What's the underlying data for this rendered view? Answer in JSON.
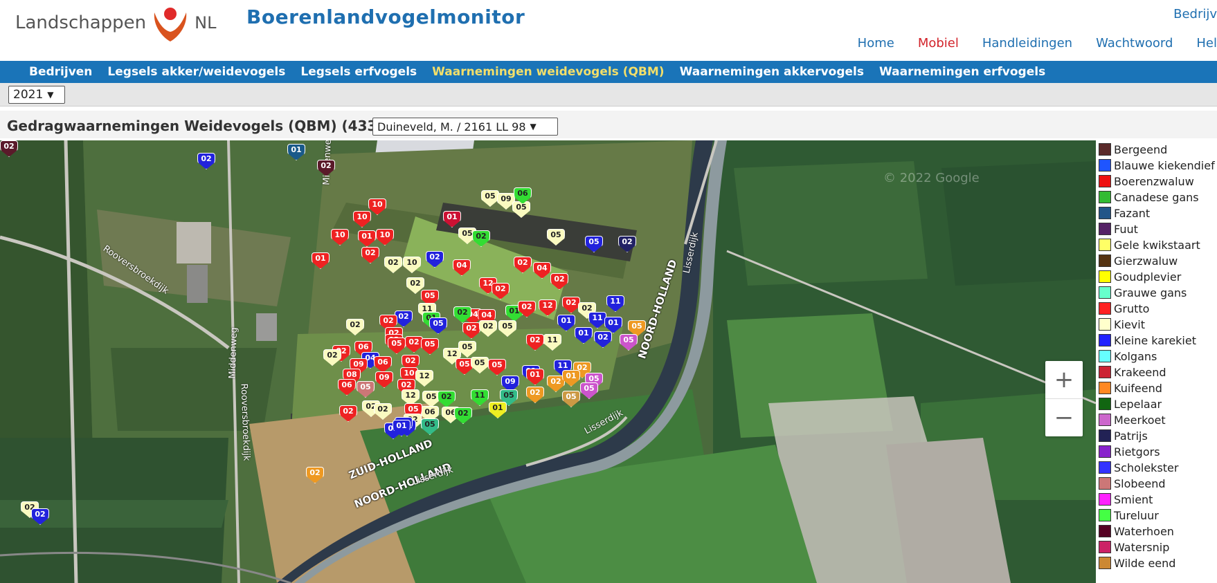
{
  "header": {
    "brand_left": "Landschappen",
    "brand_right": "NL",
    "site_title": "Boerenlandvogelmonitor",
    "top_right_link": "Bedrijv",
    "nav": [
      "Home",
      "Mobiel",
      "Handleidingen",
      "Wachtwoord",
      "Hel"
    ],
    "nav_active": "Mobiel"
  },
  "mainnav": {
    "items": [
      "Bedrijven",
      "Legsels akker/weidevogels",
      "Legsels erfvogels",
      "Waarnemingen weidevogels (QBM)",
      "Waarnemingen akkervogels",
      "Waarnemingen erfvogels"
    ],
    "active": "Waarnemingen weidevogels (QBM)"
  },
  "year_select": {
    "value": "2021"
  },
  "page": {
    "title": "Gedragwaarnemingen Weidevogels (QBM) (433)",
    "farm_select": "Duineveld, M. / 2161 LL 98"
  },
  "map": {
    "watermark": "© 2022 Google",
    "zoom_in": "+",
    "zoom_out": "−",
    "labels": {
      "zuid_holland": "ZUID-HOLLAND",
      "noord_holland_1": "NOORD-HOLLAND",
      "noord_holland_2": "NOORD-HOLLAND",
      "lisserdijk_1": "Lisserdijk",
      "lisserdijk_2": "Lisserdijk",
      "lisserdijk_3": "Lisserdijk",
      "rooversbroekdijk_1": "Rooversbroekdijk",
      "rooversbroekdijk_2": "Rooversbroekdijk",
      "middenweg_1": "Middenweg",
      "middenweg_2": "Middenweg"
    },
    "markers": [
      {
        "code": "02",
        "color": "#2222dd"
      },
      {
        "code": "01",
        "color": "#1a5a8a"
      },
      {
        "code": "02",
        "color": "#5a1a2a"
      },
      {
        "code": "05",
        "color": "#fafac0"
      },
      {
        "code": "09",
        "color": "#fafac0"
      },
      {
        "code": "05",
        "color": "#fafac0"
      },
      {
        "code": "06",
        "color": "#33dd33"
      },
      {
        "code": "10",
        "color": "#ee2222"
      },
      {
        "code": "10",
        "color": "#ee2222"
      },
      {
        "code": "10",
        "color": "#ee2222"
      },
      {
        "code": "01",
        "color": "#ee2222"
      },
      {
        "code": "10",
        "color": "#ee2222"
      },
      {
        "code": "01",
        "color": "#ee2222"
      },
      {
        "code": "02",
        "color": "#ee2222"
      },
      {
        "code": "02",
        "color": "#fafac0"
      },
      {
        "code": "10",
        "color": "#fafac0"
      },
      {
        "code": "01",
        "color": "#cc1133"
      },
      {
        "code": "05",
        "color": "#fafac0"
      },
      {
        "code": "02",
        "color": "#33dd33"
      },
      {
        "code": "02",
        "color": "#2222dd"
      },
      {
        "code": "04",
        "color": "#ee2222"
      },
      {
        "code": "05",
        "color": "#fafac0"
      },
      {
        "code": "05",
        "color": "#2222dd"
      },
      {
        "code": "02",
        "color": "#222266"
      },
      {
        "code": "02",
        "color": "#ee2222"
      },
      {
        "code": "04",
        "color": "#ee2222"
      },
      {
        "code": "02",
        "color": "#fafac0"
      },
      {
        "code": "12",
        "color": "#ee2222"
      },
      {
        "code": "02",
        "color": "#ee2222"
      },
      {
        "code": "02",
        "color": "#ee2222"
      },
      {
        "code": "05",
        "color": "#ee2222"
      },
      {
        "code": "11",
        "color": "#fafac0"
      },
      {
        "code": "01",
        "color": "#33dd33"
      },
      {
        "code": "02",
        "color": "#2222dd"
      },
      {
        "code": "04",
        "color": "#ee2222"
      },
      {
        "code": "04",
        "color": "#ee2222"
      },
      {
        "code": "01",
        "color": "#33dd33"
      },
      {
        "code": "02",
        "color": "#ee2222"
      },
      {
        "code": "12",
        "color": "#ee2222"
      },
      {
        "code": "02",
        "color": "#ee2222"
      },
      {
        "code": "02",
        "color": "#fafac0"
      },
      {
        "code": "11",
        "color": "#2222dd"
      },
      {
        "code": "02",
        "color": "#fafac0"
      },
      {
        "code": "02",
        "color": "#ee2222"
      },
      {
        "code": "05",
        "color": "#2222dd"
      },
      {
        "code": "02",
        "color": "#ee2222"
      },
      {
        "code": "02",
        "color": "#33dd33"
      },
      {
        "code": "02",
        "color": "#ee2222"
      },
      {
        "code": "02",
        "color": "#fafac0"
      },
      {
        "code": "05",
        "color": "#fafac0"
      },
      {
        "code": "01",
        "color": "#2222dd"
      },
      {
        "code": "11",
        "color": "#2222dd"
      },
      {
        "code": "01",
        "color": "#2222dd"
      },
      {
        "code": "05",
        "color": "#ee9922"
      },
      {
        "code": "02",
        "color": "#ee2222"
      },
      {
        "code": "06",
        "color": "#ee2222"
      },
      {
        "code": "04",
        "color": "#2222dd"
      },
      {
        "code": "02",
        "color": "#ee2222"
      },
      {
        "code": "02",
        "color": "#fafac0"
      },
      {
        "code": "05",
        "color": "#ee2222"
      },
      {
        "code": "02",
        "color": "#ee2222"
      },
      {
        "code": "05",
        "color": "#ee2222"
      },
      {
        "code": "12",
        "color": "#fafac0"
      },
      {
        "code": "05",
        "color": "#fafac0"
      },
      {
        "code": "02",
        "color": "#ee2222"
      },
      {
        "code": "11",
        "color": "#fafac0"
      },
      {
        "code": "01",
        "color": "#2222dd"
      },
      {
        "code": "02",
        "color": "#2222dd"
      },
      {
        "code": "05",
        "color": "#cc55cc"
      },
      {
        "code": "09",
        "color": "#ee2222"
      },
      {
        "code": "06",
        "color": "#ee2222"
      },
      {
        "code": "02",
        "color": "#ee2222"
      },
      {
        "code": "10",
        "color": "#ee2222"
      },
      {
        "code": "12",
        "color": "#fafac0"
      },
      {
        "code": "05",
        "color": "#ee2222"
      },
      {
        "code": "05",
        "color": "#fafac0"
      },
      {
        "code": "05",
        "color": "#ee2222"
      },
      {
        "code": "11",
        "color": "#2222dd"
      },
      {
        "code": "02",
        "color": "#ee9922"
      },
      {
        "code": "08",
        "color": "#ee2222"
      },
      {
        "code": "09",
        "color": "#ee2222"
      },
      {
        "code": "02",
        "color": "#ee2222"
      },
      {
        "code": "01",
        "color": "#2222dd"
      },
      {
        "code": "09",
        "color": "#2222dd"
      },
      {
        "code": "01",
        "color": "#ee2222"
      },
      {
        "code": "02",
        "color": "#ee9922"
      },
      {
        "code": "01",
        "color": "#ee9922"
      },
      {
        "code": "05",
        "color": "#cc55cc"
      },
      {
        "code": "06",
        "color": "#ee2222"
      },
      {
        "code": "05",
        "color": "#cc7777"
      },
      {
        "code": "12",
        "color": "#fafac0"
      },
      {
        "code": "05",
        "color": "#fafac0"
      },
      {
        "code": "02",
        "color": "#33dd33"
      },
      {
        "code": "11",
        "color": "#33dd33"
      },
      {
        "code": "05",
        "color": "#33bb88"
      },
      {
        "code": "02",
        "color": "#ee9922"
      },
      {
        "code": "05",
        "color": "#cc9944"
      },
      {
        "code": "05",
        "color": "#cc55cc"
      },
      {
        "code": "06",
        "color": "#fafac0"
      },
      {
        "code": "02",
        "color": "#fafac0"
      },
      {
        "code": "02",
        "color": "#fafac0"
      },
      {
        "code": "05",
        "color": "#ee2222"
      },
      {
        "code": "06",
        "color": "#fafac0"
      },
      {
        "code": "02",
        "color": "#33dd33"
      },
      {
        "code": "01",
        "color": "#eeee22"
      },
      {
        "code": "02",
        "color": "#ee2222"
      },
      {
        "code": "02",
        "color": "#fafac0"
      },
      {
        "code": "02",
        "color": "#2222dd"
      },
      {
        "code": "01",
        "color": "#2222dd"
      },
      {
        "code": "05",
        "color": "#33bb88"
      },
      {
        "code": "02",
        "color": "#ee9922"
      },
      {
        "code": "02",
        "color": "#2222dd"
      },
      {
        "code": "01",
        "color": "#2222dd"
      },
      {
        "code": "02",
        "color": "#fafac0"
      },
      {
        "code": "02",
        "color": "#2222dd"
      },
      {
        "code": "02",
        "color": "#5a1a2a"
      }
    ]
  },
  "legend": [
    {
      "label": "Bergeend",
      "color": "#5a2a2a"
    },
    {
      "label": "Blauwe kiekendief",
      "color": "#1f55ff"
    },
    {
      "label": "Boerenzwaluw",
      "color": "#ee1111"
    },
    {
      "label": "Canadese gans",
      "color": "#33bb33"
    },
    {
      "label": "Fazant",
      "color": "#225588"
    },
    {
      "label": "Fuut",
      "color": "#552266"
    },
    {
      "label": "Gele kwikstaart",
      "color": "#ffff66"
    },
    {
      "label": "Gierzwaluw",
      "color": "#553311"
    },
    {
      "label": "Goudplevier",
      "color": "#ffff00"
    },
    {
      "label": "Grauwe gans",
      "color": "#66ffcc"
    },
    {
      "label": "Grutto",
      "color": "#ff2222"
    },
    {
      "label": "Kievit",
      "color": "#ffffcc"
    },
    {
      "label": "Kleine karekiet",
      "color": "#2222ff"
    },
    {
      "label": "Kolgans",
      "color": "#66ffff"
    },
    {
      "label": "Krakeend",
      "color": "#cc2233"
    },
    {
      "label": "Kuifeend",
      "color": "#ff8822"
    },
    {
      "label": "Lepelaar",
      "color": "#116611"
    },
    {
      "label": "Meerkoet",
      "color": "#cc66cc"
    },
    {
      "label": "Patrijs",
      "color": "#222255"
    },
    {
      "label": "Rietgors",
      "color": "#8822cc"
    },
    {
      "label": "Scholekster",
      "color": "#3333ff"
    },
    {
      "label": "Slobeend",
      "color": "#cc7777"
    },
    {
      "label": "Smient",
      "color": "#ff22ff"
    },
    {
      "label": "Tureluur",
      "color": "#44ff44"
    },
    {
      "label": "Waterhoen",
      "color": "#550022"
    },
    {
      "label": "Watersnip",
      "color": "#cc2266"
    },
    {
      "label": "Wilde eend",
      "color": "#cc8833"
    }
  ]
}
